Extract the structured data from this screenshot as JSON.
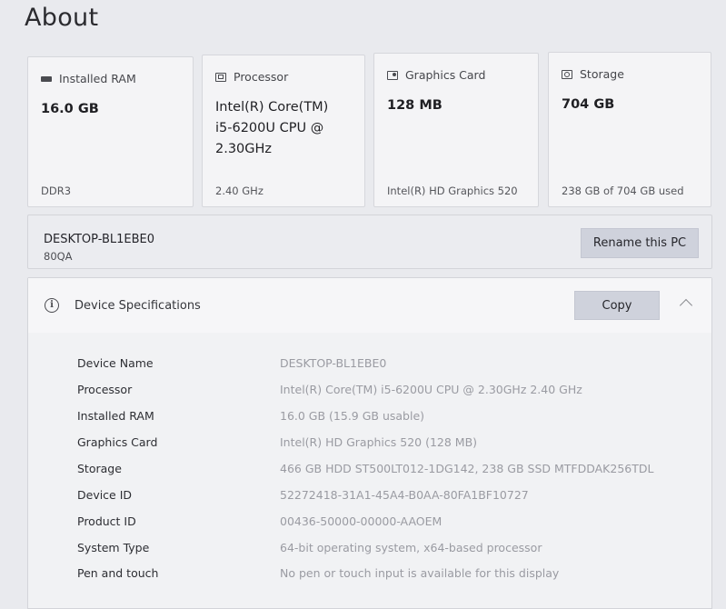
{
  "title": "About",
  "cards": [
    {
      "key": "ram",
      "label": "Installed RAM",
      "icon": "memory-icon",
      "value_lines": [
        "16.0 GB"
      ],
      "footer": "DDR3"
    },
    {
      "key": "cpu",
      "label": "Processor",
      "icon": "processor-icon",
      "value_lines": [
        "Intel(R) Core(TM)",
        "i5-6200U CPU @",
        "2.30GHz"
      ],
      "footer": "2.40 GHz"
    },
    {
      "key": "gpu",
      "label": "Graphics Card",
      "icon": "graphics-card-icon",
      "value_lines": [
        "128 MB"
      ],
      "footer": "Intel(R) HD Graphics 520"
    },
    {
      "key": "disk",
      "label": "Storage",
      "icon": "storage-icon",
      "value_lines": [
        "704 GB"
      ],
      "footer": "238 GB of 704 GB used"
    }
  ],
  "pc": {
    "name": "DESKTOP-BL1EBE0",
    "model": "80QA",
    "rename_label": "Rename this PC"
  },
  "specs": {
    "title": "Device Specifications",
    "copy_label": "Copy",
    "rows": [
      {
        "label": "Device Name",
        "value": "DESKTOP-BL1EBE0"
      },
      {
        "label": "Processor",
        "value": "Intel(R) Core(TM) i5-6200U CPU @ 2.30GHz   2.40 GHz"
      },
      {
        "label": "Installed RAM",
        "value": "16.0 GB (15.9 GB usable)"
      },
      {
        "label": "Graphics Card",
        "value": "Intel(R) HD Graphics 520 (128 MB)"
      },
      {
        "label": "Storage",
        "value": "466 GB HDD ST500LT012-1DG142, 238 GB SSD MTFDDAK256TDL"
      },
      {
        "label": "Device ID",
        "value": "52272418-31A1-45A4-B0AA-80FA1BF10727"
      },
      {
        "label": "Product ID",
        "value": "00436-50000-00000-AAOEM"
      },
      {
        "label": "System Type",
        "value": "64-bit operating system, x64-based processor"
      },
      {
        "label": "Pen and touch",
        "value": "No pen or touch input is available for this display"
      }
    ]
  }
}
